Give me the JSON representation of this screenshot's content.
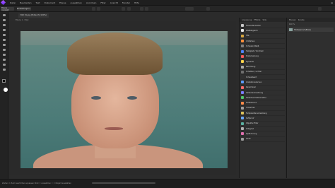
{
  "menubar": {
    "items": [
      "Datei",
      "Bearbeiten",
      "Text",
      "Dokument",
      "Ebene",
      "Auswählen",
      "Anordnen",
      "Filter",
      "Ansicht",
      "Fenster",
      "Hilfe"
    ],
    "right": "⊞"
  },
  "toolbar": {
    "persona_label": "Ebene Auswahl",
    "mode_label": "Einstellungen..."
  },
  "document": {
    "tab_label": "Bild 01.jpg (Entwurf) (100%)",
    "meta": "Ebene 1 · Pixel"
  },
  "adjustments": {
    "tabs": [
      "Anpassung",
      "Effekte",
      "Stile"
    ],
    "items": [
      {
        "label": "Tonwertkorrektur",
        "color": "#c9c9c9"
      },
      {
        "label": "Weißabgleich",
        "color": "#e9e9e9"
      },
      {
        "label": "HSL",
        "color": "#d8a640"
      },
      {
        "label": "Umfärben",
        "color": "#ff8f3a"
      },
      {
        "label": "Schwarz-/Weiß",
        "color": "#808080"
      },
      {
        "label": "Helligkeit / Kontrast",
        "color": "#4f83ff"
      },
      {
        "label": "Posterisierung",
        "color": "#ff5a5a"
      },
      {
        "label": "Dynamik",
        "color": "#ffd24a"
      },
      {
        "label": "Belichtung",
        "color": "#aaaaaa"
      },
      {
        "label": "Schatten / Lichter",
        "color": "#6f6f6f"
      },
      {
        "label": "Schwellwert",
        "color": "#303030"
      },
      {
        "label": "Gradationskurven",
        "color": "#5c9bff"
      },
      {
        "label": "Kanalmixer",
        "color": "#ff6b6b"
      },
      {
        "label": "Verlaufsumsetzung",
        "color": "#7c7cff"
      },
      {
        "label": "Selektive Farbkorrektur",
        "color": "#51c46a"
      },
      {
        "label": "Farbbalance",
        "color": "#ff8c4a"
      },
      {
        "label": "Umkehren",
        "color": "#9f9f9f"
      },
      {
        "label": "Farbpalettenumsetzung",
        "color": "#e0c35a"
      },
      {
        "label": "Softproof",
        "color": "#6aa9ff"
      },
      {
        "label": "Objektiv-Filter",
        "color": "#5ab0a0"
      },
      {
        "label": "Ortsgrad",
        "color": "#b0b0b0"
      },
      {
        "label": "Splitt-Toning",
        "color": "#e06fae"
      },
      {
        "label": "OCIO",
        "color": "#9d9d9d"
      }
    ]
  },
  "layers": {
    "tabs": [
      "Ebenen",
      "Kanäle"
    ],
    "opacity_label": "100 %",
    "layer_name": "Hintergrund (Pixel)"
  },
  "status": {
    "text": "Ziehen = Zum Ausrichten anpassen  Klick = Auswählen  ⇧ = Objekt auswählen"
  }
}
